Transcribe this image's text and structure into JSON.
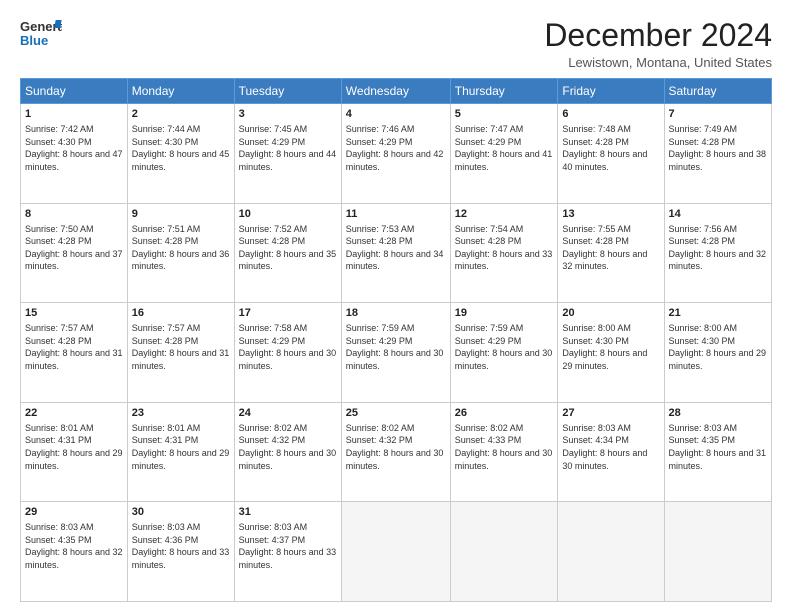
{
  "header": {
    "logo_line1": "General",
    "logo_line2": "Blue",
    "month": "December 2024",
    "location": "Lewistown, Montana, United States"
  },
  "days_of_week": [
    "Sunday",
    "Monday",
    "Tuesday",
    "Wednesday",
    "Thursday",
    "Friday",
    "Saturday"
  ],
  "weeks": [
    [
      {
        "day": "1",
        "sunrise": "Sunrise: 7:42 AM",
        "sunset": "Sunset: 4:30 PM",
        "daylight": "Daylight: 8 hours and 47 minutes."
      },
      {
        "day": "2",
        "sunrise": "Sunrise: 7:44 AM",
        "sunset": "Sunset: 4:30 PM",
        "daylight": "Daylight: 8 hours and 45 minutes."
      },
      {
        "day": "3",
        "sunrise": "Sunrise: 7:45 AM",
        "sunset": "Sunset: 4:29 PM",
        "daylight": "Daylight: 8 hours and 44 minutes."
      },
      {
        "day": "4",
        "sunrise": "Sunrise: 7:46 AM",
        "sunset": "Sunset: 4:29 PM",
        "daylight": "Daylight: 8 hours and 42 minutes."
      },
      {
        "day": "5",
        "sunrise": "Sunrise: 7:47 AM",
        "sunset": "Sunset: 4:29 PM",
        "daylight": "Daylight: 8 hours and 41 minutes."
      },
      {
        "day": "6",
        "sunrise": "Sunrise: 7:48 AM",
        "sunset": "Sunset: 4:28 PM",
        "daylight": "Daylight: 8 hours and 40 minutes."
      },
      {
        "day": "7",
        "sunrise": "Sunrise: 7:49 AM",
        "sunset": "Sunset: 4:28 PM",
        "daylight": "Daylight: 8 hours and 38 minutes."
      }
    ],
    [
      {
        "day": "8",
        "sunrise": "Sunrise: 7:50 AM",
        "sunset": "Sunset: 4:28 PM",
        "daylight": "Daylight: 8 hours and 37 minutes."
      },
      {
        "day": "9",
        "sunrise": "Sunrise: 7:51 AM",
        "sunset": "Sunset: 4:28 PM",
        "daylight": "Daylight: 8 hours and 36 minutes."
      },
      {
        "day": "10",
        "sunrise": "Sunrise: 7:52 AM",
        "sunset": "Sunset: 4:28 PM",
        "daylight": "Daylight: 8 hours and 35 minutes."
      },
      {
        "day": "11",
        "sunrise": "Sunrise: 7:53 AM",
        "sunset": "Sunset: 4:28 PM",
        "daylight": "Daylight: 8 hours and 34 minutes."
      },
      {
        "day": "12",
        "sunrise": "Sunrise: 7:54 AM",
        "sunset": "Sunset: 4:28 PM",
        "daylight": "Daylight: 8 hours and 33 minutes."
      },
      {
        "day": "13",
        "sunrise": "Sunrise: 7:55 AM",
        "sunset": "Sunset: 4:28 PM",
        "daylight": "Daylight: 8 hours and 32 minutes."
      },
      {
        "day": "14",
        "sunrise": "Sunrise: 7:56 AM",
        "sunset": "Sunset: 4:28 PM",
        "daylight": "Daylight: 8 hours and 32 minutes."
      }
    ],
    [
      {
        "day": "15",
        "sunrise": "Sunrise: 7:57 AM",
        "sunset": "Sunset: 4:28 PM",
        "daylight": "Daylight: 8 hours and 31 minutes."
      },
      {
        "day": "16",
        "sunrise": "Sunrise: 7:57 AM",
        "sunset": "Sunset: 4:28 PM",
        "daylight": "Daylight: 8 hours and 31 minutes."
      },
      {
        "day": "17",
        "sunrise": "Sunrise: 7:58 AM",
        "sunset": "Sunset: 4:29 PM",
        "daylight": "Daylight: 8 hours and 30 minutes."
      },
      {
        "day": "18",
        "sunrise": "Sunrise: 7:59 AM",
        "sunset": "Sunset: 4:29 PM",
        "daylight": "Daylight: 8 hours and 30 minutes."
      },
      {
        "day": "19",
        "sunrise": "Sunrise: 7:59 AM",
        "sunset": "Sunset: 4:29 PM",
        "daylight": "Daylight: 8 hours and 30 minutes."
      },
      {
        "day": "20",
        "sunrise": "Sunrise: 8:00 AM",
        "sunset": "Sunset: 4:30 PM",
        "daylight": "Daylight: 8 hours and 29 minutes."
      },
      {
        "day": "21",
        "sunrise": "Sunrise: 8:00 AM",
        "sunset": "Sunset: 4:30 PM",
        "daylight": "Daylight: 8 hours and 29 minutes."
      }
    ],
    [
      {
        "day": "22",
        "sunrise": "Sunrise: 8:01 AM",
        "sunset": "Sunset: 4:31 PM",
        "daylight": "Daylight: 8 hours and 29 minutes."
      },
      {
        "day": "23",
        "sunrise": "Sunrise: 8:01 AM",
        "sunset": "Sunset: 4:31 PM",
        "daylight": "Daylight: 8 hours and 29 minutes."
      },
      {
        "day": "24",
        "sunrise": "Sunrise: 8:02 AM",
        "sunset": "Sunset: 4:32 PM",
        "daylight": "Daylight: 8 hours and 30 minutes."
      },
      {
        "day": "25",
        "sunrise": "Sunrise: 8:02 AM",
        "sunset": "Sunset: 4:32 PM",
        "daylight": "Daylight: 8 hours and 30 minutes."
      },
      {
        "day": "26",
        "sunrise": "Sunrise: 8:02 AM",
        "sunset": "Sunset: 4:33 PM",
        "daylight": "Daylight: 8 hours and 30 minutes."
      },
      {
        "day": "27",
        "sunrise": "Sunrise: 8:03 AM",
        "sunset": "Sunset: 4:34 PM",
        "daylight": "Daylight: 8 hours and 30 minutes."
      },
      {
        "day": "28",
        "sunrise": "Sunrise: 8:03 AM",
        "sunset": "Sunset: 4:35 PM",
        "daylight": "Daylight: 8 hours and 31 minutes."
      }
    ],
    [
      {
        "day": "29",
        "sunrise": "Sunrise: 8:03 AM",
        "sunset": "Sunset: 4:35 PM",
        "daylight": "Daylight: 8 hours and 32 minutes."
      },
      {
        "day": "30",
        "sunrise": "Sunrise: 8:03 AM",
        "sunset": "Sunset: 4:36 PM",
        "daylight": "Daylight: 8 hours and 33 minutes."
      },
      {
        "day": "31",
        "sunrise": "Sunrise: 8:03 AM",
        "sunset": "Sunset: 4:37 PM",
        "daylight": "Daylight: 8 hours and 33 minutes."
      },
      null,
      null,
      null,
      null
    ]
  ]
}
